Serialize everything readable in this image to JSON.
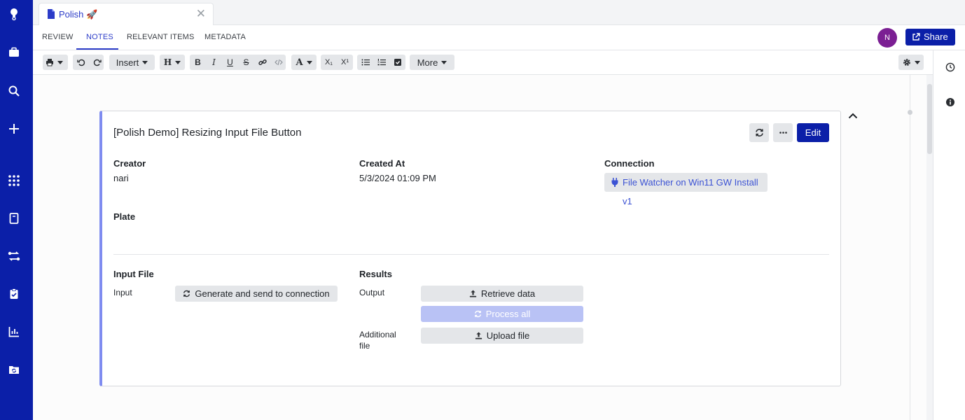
{
  "tab": {
    "title": "Polish 🚀"
  },
  "nav": {
    "tabs": [
      {
        "label": "REVIEW"
      },
      {
        "label": "NOTES"
      },
      {
        "label": "RELEVANT ITEMS"
      },
      {
        "label": "METADATA"
      }
    ],
    "active_tab": "NOTES"
  },
  "user": {
    "avatar_initial": "N"
  },
  "share": {
    "label": "Share"
  },
  "toolbar": {
    "insert_label": "Insert",
    "heading_label": "H",
    "bold": "B",
    "italic": "I",
    "underline": "U",
    "strike": "S",
    "text_color": "A",
    "subscript": "X₁",
    "superscript": "X¹",
    "more_label": "More"
  },
  "card": {
    "title": "[Polish Demo] Resizing Input File Button",
    "edit_label": "Edit",
    "creator_label": "Creator",
    "creator_value": "nari",
    "created_at_label": "Created At",
    "created_at_value": "5/3/2024 01:09 PM",
    "connection_label": "Connection",
    "connection_value": "File Watcher on Win11 GW Install v1",
    "plate_label": "Plate",
    "input_file_label": "Input File",
    "input_label": "Input",
    "generate_label": "Generate and send to connection",
    "results_label": "Results",
    "output_label": "Output",
    "retrieve_label": "Retrieve data",
    "process_all_label": "Process all",
    "additional_file_label_1": "Additional",
    "additional_file_label_2": "file",
    "upload_label": "Upload file"
  },
  "colors": {
    "nav_blue": "#0b1fa8",
    "accent_blue": "#2c3cc8",
    "card_accent": "#7f8cf0",
    "avatar_purple": "#7b1f93",
    "disabled_button": "#b9c2f5"
  }
}
